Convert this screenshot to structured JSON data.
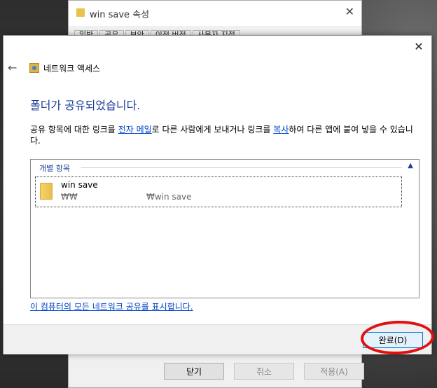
{
  "background_window": {
    "title": "win save 속성",
    "tabs": [
      "일반",
      "공유",
      "보안",
      "이전 버전",
      "사용자 지정"
    ],
    "buttons": {
      "close": "닫기",
      "cancel": "취소",
      "apply": "적용(A)"
    }
  },
  "dialog": {
    "nav_title": "네트워크 액세스",
    "heading": "폴더가 공유되었습니다.",
    "description": {
      "part1": "공유 항목에 대한 링크를 ",
      "email_link": "전자 메일",
      "part2": "로 다른 사람에게 보내거나 링크를 ",
      "copy_link": "복사",
      "part3": "하여 다른 앱에 붙여 넣을 수 있습니다."
    },
    "group_header": "개별 항목",
    "items": [
      {
        "name": "win save",
        "path_prefix": "₩₩",
        "path_suffix": "₩win save"
      }
    ],
    "show_all_shares_link": "이 컴퓨터의 모든 네트워크 공유를 표시합니다.",
    "done_button": "완료(D)"
  },
  "colors": {
    "heading_blue": "#1e3f9a",
    "link_blue": "#0044cc",
    "annotation_red": "#e01010",
    "focus_border": "#0078d7"
  }
}
